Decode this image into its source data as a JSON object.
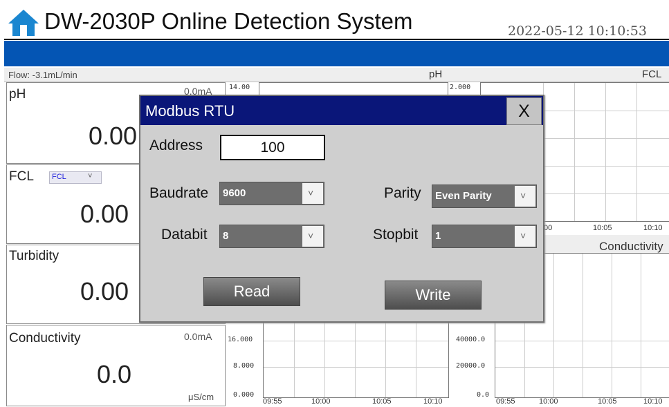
{
  "header": {
    "icon": "home-icon",
    "title": "DW-2030P Online Detection System",
    "datetime": "2022-05-12 10:10:53",
    "accent_color": "#0455b4"
  },
  "status": {
    "flow": "Flow: -3.1mL/min",
    "ph_chart_title": "pH",
    "fcl_chart_title": "FCL"
  },
  "panels": {
    "ph": {
      "name": "pH",
      "current": "0.0mA",
      "value": "0.00"
    },
    "fcl": {
      "name": "FCL",
      "select_value": "FCL",
      "select_arrow": "˅",
      "value": "0.00"
    },
    "turbidity": {
      "name": "Turbidity",
      "value": "0.00"
    },
    "conductivity": {
      "name": "Conductivity",
      "current": "0.0mA",
      "value": "0.0",
      "unit": "μS/cm"
    }
  },
  "charts": {
    "ph_top": "14.00",
    "fcl_top": "2.000",
    "conductivity_label": "Conductivity",
    "mid_time_labels": [
      "00",
      "10:05",
      "10:10"
    ],
    "left_bottom_ticks": [
      "16.000",
      "8.000",
      "0.000"
    ],
    "right_bottom_ticks": [
      "40000.0",
      "20000.0",
      "0.0"
    ],
    "time_labels": [
      "09:55",
      "10:00",
      "10:05",
      "10:10"
    ]
  },
  "dialog": {
    "title": "Modbus RTU",
    "close_label": "X",
    "address_label": "Address",
    "address_value": "100",
    "baudrate_label": "Baudrate",
    "baudrate_value": "9600",
    "parity_label": "Parity",
    "parity_value": "Even Parity",
    "databit_label": "Databit",
    "databit_value": "8",
    "stopbit_label": "Stopbit",
    "stopbit_value": "1",
    "dropdown_arrow": "˅",
    "read_label": "Read",
    "write_label": "Write",
    "titlebar_color": "#0a1679"
  }
}
